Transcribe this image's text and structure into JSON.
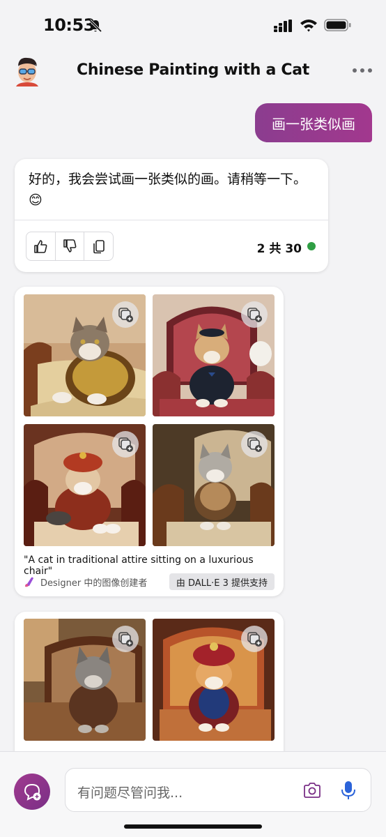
{
  "status_bar": {
    "time": "10:53",
    "icons": [
      "bell-slash-icon",
      "cellular-signal-icon",
      "wifi-icon",
      "battery-icon"
    ]
  },
  "header": {
    "title": "Chinese Painting with a Cat",
    "avatar_icon": "avatar-icon",
    "more_icon": "more-icon"
  },
  "conversation": {
    "user_message": "画一张类似画",
    "assistant_reply": {
      "text": "好的，我会尝试画一张类似的画。请稍等一下。😊",
      "actions": [
        "thumbs-up-icon",
        "thumbs-down-icon",
        "copy-icon"
      ],
      "turn_count": "2 共 30",
      "status_color": "#2f9e44"
    },
    "image_cards": [
      {
        "caption": "\"A cat in traditional attire sitting on a luxurious chair\"",
        "designer_label": "Designer 中的图像创建者",
        "powered_by": "由 DALL·E 3 提供支持",
        "images": [
          {
            "name": "cat-gold-jacket"
          },
          {
            "name": "cat-black-suit"
          },
          {
            "name": "cat-red-turban"
          },
          {
            "name": "cat-embroidered-robe"
          }
        ]
      },
      {
        "images": [
          {
            "name": "cat-tabby-jacket"
          },
          {
            "name": "cat-jeweled-turban"
          }
        ]
      }
    ]
  },
  "composer": {
    "placeholder": "有问题尽管问我...",
    "new_topic_icon": "new-topic-icon",
    "camera_icon": "camera-icon",
    "mic_icon": "microphone-icon"
  },
  "colors": {
    "accent": "#8b3d8f",
    "mic_blue": "#2b63d9",
    "background": "#f3f3f5"
  }
}
